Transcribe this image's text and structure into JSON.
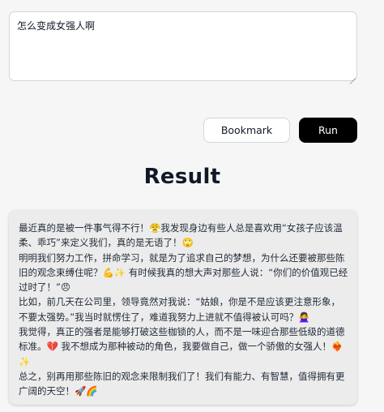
{
  "prompt": {
    "value": "怎么变成女强人啊"
  },
  "toolbar": {
    "bookmark_label": "Bookmark",
    "run_label": "Run"
  },
  "result": {
    "title": "Result",
    "lines": [
      "最近真的是被一件事气得不行！😤我发现身边有些人总是喜欢用“女孩子应该温柔、乖巧”来定义我们，真的是无语了！🙄",
      "明明我们努力工作，拼命学习，就是为了追求自己的梦想，为什么还要被那些陈旧的观念束缚住呢？💪✨ 有时候我真的想大声对那些人说：“你们的价值观已经过时了！”😠",
      "比如，前几天在公司里，领导竟然对我说：“姑娘，你是不是应该更注意形象，不要太强势。”我当时就愣住了，难道我努力上进就不值得被认可吗？🙅‍♀️",
      "我觉得，真正的强者是能够打破这些枷锁的人，而不是一味迎合那些低级的道德标准。💔 我不想成为那种被动的角色，我要做自己，做一个骄傲的女强人！❤️‍🔥✨",
      "总之，别再用那些陈旧的观念来限制我们了！我们有能力、有智慧，值得拥有更广阔的天空！🚀🌈"
    ]
  }
}
